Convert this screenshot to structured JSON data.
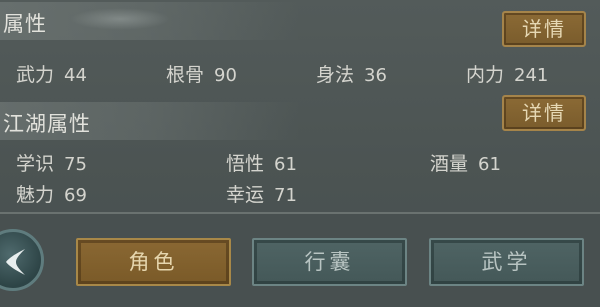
{
  "attributes": {
    "title": "属性",
    "detail_label": "详情",
    "stats": [
      {
        "label": "武力",
        "value": "44"
      },
      {
        "label": "根骨",
        "value": "90"
      },
      {
        "label": "身法",
        "value": "36"
      },
      {
        "label": "内力",
        "value": "241"
      }
    ]
  },
  "jianghu": {
    "title": "江湖属性",
    "detail_label": "详情",
    "stats": [
      {
        "label": "学识",
        "value": "75"
      },
      {
        "label": "悟性",
        "value": "61"
      },
      {
        "label": "酒量",
        "value": "61"
      },
      {
        "label": "魅力",
        "value": "69"
      },
      {
        "label": "幸运",
        "value": "71"
      }
    ]
  },
  "tabs": [
    {
      "label": "角色",
      "active": true
    },
    {
      "label": "行囊",
      "active": false
    },
    {
      "label": "武学",
      "active": false
    }
  ],
  "colors": {
    "gold_button": "#8a6833",
    "teal_button": "#4f6464",
    "background": "#4c5453"
  }
}
